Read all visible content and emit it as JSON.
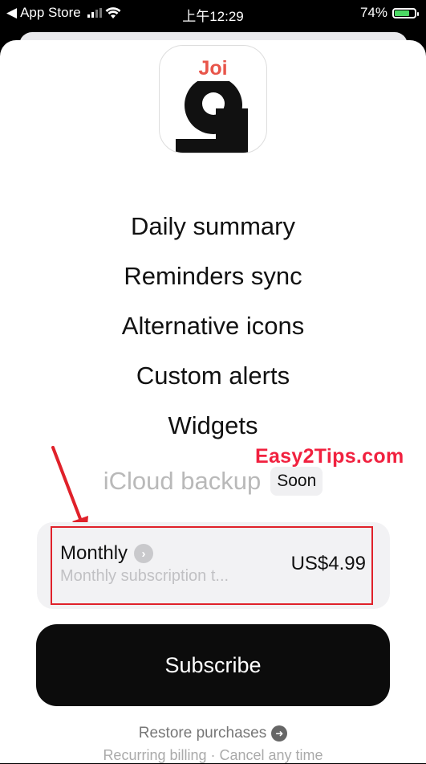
{
  "status_bar": {
    "back_label": "App Store",
    "time": "上午12:29",
    "battery": "74%",
    "battery_level": 0.74
  },
  "app": {
    "icon_title": "Joi"
  },
  "features": [
    {
      "label": "Daily summary"
    },
    {
      "label": "Reminders sync"
    },
    {
      "label": "Alternative icons"
    },
    {
      "label": "Custom alerts"
    },
    {
      "label": "Widgets"
    },
    {
      "label": "iCloud backup",
      "badge": "Soon"
    }
  ],
  "watermark": "Easy2Tips.com",
  "plan": {
    "name": "Monthly",
    "description": "Monthly subscription t...",
    "price": "US$4.99"
  },
  "subscribe_label": "Subscribe",
  "restore_label": "Restore purchases",
  "footnote": "Recurring billing · Cancel any time",
  "colors": {
    "accent": "#e8554a",
    "highlight": "#e0212a",
    "watermark": "#f1213f",
    "button": "#0c0c0c"
  }
}
